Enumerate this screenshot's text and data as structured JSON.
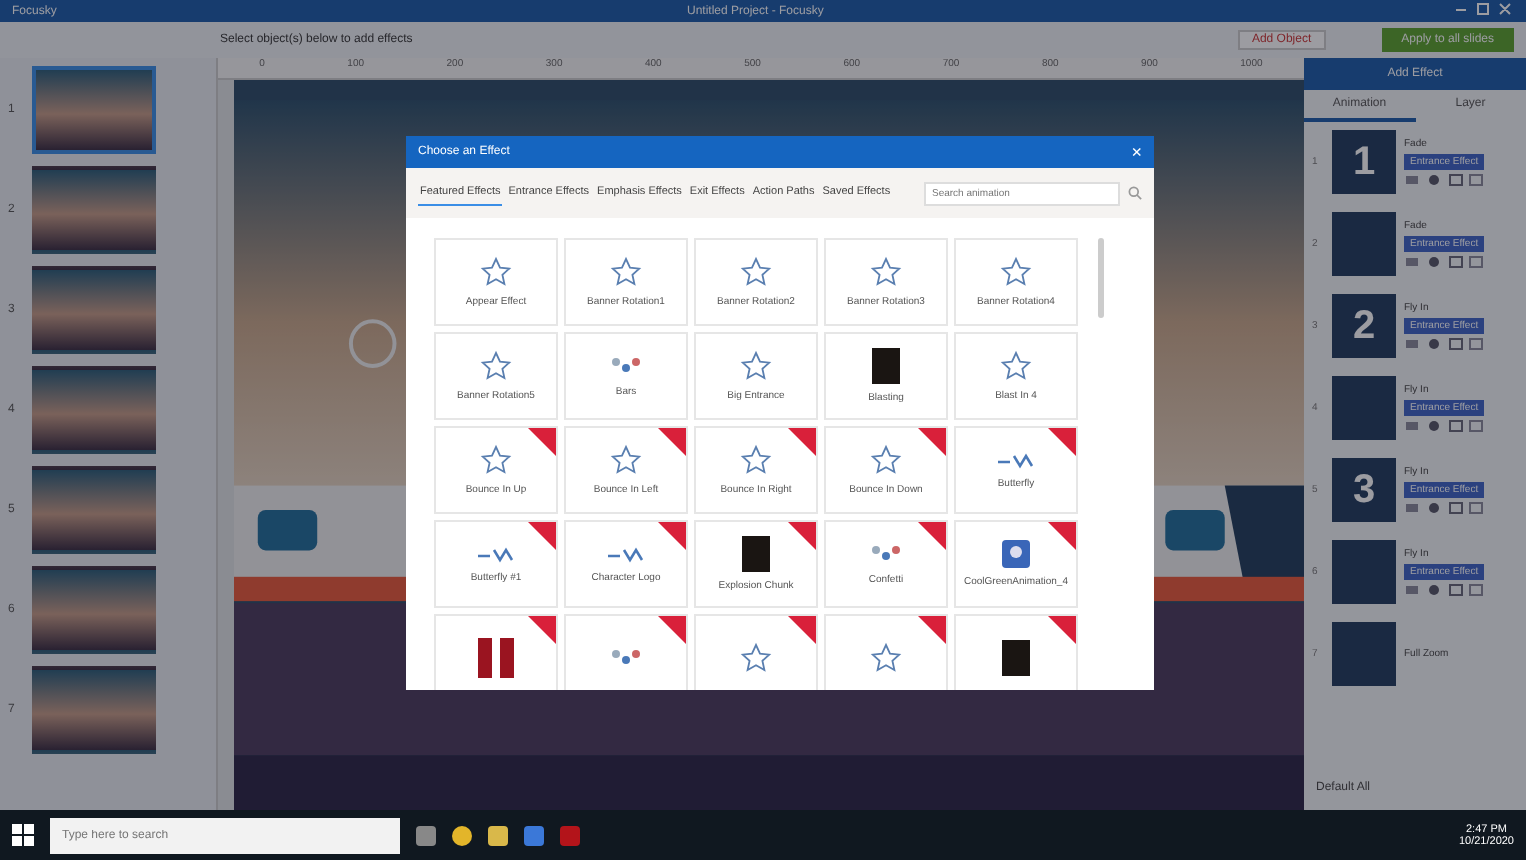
{
  "window": {
    "app": "Focusky",
    "title": "Untitled Project - Focusky"
  },
  "toolbar": {
    "hint": "Select object(s) below to add effects",
    "add_object": "Add Object",
    "apply_button": "Apply to all slides"
  },
  "ruler": [
    "0",
    "100",
    "200",
    "300",
    "400",
    "500",
    "600",
    "700",
    "800",
    "900",
    "1000"
  ],
  "slides": [
    {
      "number": "1",
      "selected": true
    },
    {
      "number": "2",
      "selected": false
    },
    {
      "number": "3",
      "selected": false
    },
    {
      "number": "4",
      "selected": false
    },
    {
      "number": "5",
      "selected": false
    },
    {
      "number": "6",
      "selected": false
    },
    {
      "number": "7",
      "selected": false
    }
  ],
  "dialog": {
    "title": "Choose an Effect",
    "close": "×",
    "tabs": [
      {
        "label": "Featured Effects",
        "selected": true
      },
      {
        "label": "Entrance Effects",
        "selected": false
      },
      {
        "label": "Emphasis Effects",
        "selected": false
      },
      {
        "label": "Exit Effects",
        "selected": false
      },
      {
        "label": "Action Paths",
        "selected": false
      },
      {
        "label": "Saved Effects",
        "selected": false
      }
    ],
    "search": {
      "placeholder": "Search animation"
    },
    "effects": [
      {
        "label": "Appear Effect",
        "kind": "star",
        "premium": false
      },
      {
        "label": "Banner Rotation1",
        "kind": "star",
        "premium": false
      },
      {
        "label": "Banner Rotation2",
        "kind": "star",
        "premium": false
      },
      {
        "label": "Banner Rotation3",
        "kind": "star",
        "premium": false
      },
      {
        "label": "Banner Rotation4",
        "kind": "star",
        "premium": false
      },
      {
        "label": "Banner Rotation5",
        "kind": "star",
        "premium": false
      },
      {
        "label": "Bars",
        "kind": "dots",
        "premium": false
      },
      {
        "label": "Big Entrance",
        "kind": "star",
        "premium": false
      },
      {
        "label": "Blasting",
        "kind": "dark",
        "premium": false
      },
      {
        "label": "Blast In 4",
        "kind": "star",
        "premium": false
      },
      {
        "label": "Bounce In Up",
        "kind": "star",
        "premium": true
      },
      {
        "label": "Bounce In Left",
        "kind": "star",
        "premium": true
      },
      {
        "label": "Bounce In Right",
        "kind": "star",
        "premium": true
      },
      {
        "label": "Bounce In Down",
        "kind": "star",
        "premium": true
      },
      {
        "label": "Butterfly",
        "kind": "logo",
        "premium": true
      },
      {
        "label": "Butterfly #1",
        "kind": "logo",
        "premium": true
      },
      {
        "label": "Character Logo",
        "kind": "logo",
        "premium": true
      },
      {
        "label": "Explosion Chunk",
        "kind": "dark",
        "premium": true
      },
      {
        "label": "Confetti",
        "kind": "dots",
        "premium": true
      },
      {
        "label": "CoolGreenAnimation_4",
        "kind": "square",
        "premium": true
      },
      {
        "kind": "red",
        "premium": true
      },
      {
        "kind": "dots",
        "premium": true
      },
      {
        "kind": "star",
        "premium": true
      },
      {
        "kind": "star",
        "premium": true
      },
      {
        "kind": "dark",
        "premium": true
      }
    ]
  },
  "panel": {
    "add_effect": "Add Effect",
    "tabs": [
      {
        "label": "Animation",
        "selected": true
      },
      {
        "label": "Layer",
        "selected": false
      }
    ],
    "items": [
      {
        "index": "1",
        "thumb": "1",
        "name": "Fade",
        "effect": "Entrance Effect"
      },
      {
        "index": "2",
        "name": "Fade",
        "effect": "Entrance Effect"
      },
      {
        "index": "3",
        "thumb": "2",
        "name": "Fly In",
        "effect": "Entrance Effect"
      },
      {
        "index": "4",
        "name": "Fly In",
        "effect": "Entrance Effect"
      },
      {
        "index": "5",
        "thumb": "3",
        "name": "Fly In",
        "effect": "Entrance Effect"
      },
      {
        "index": "6",
        "name": "Fly In",
        "effect": "Entrance Effect"
      },
      {
        "index": "7",
        "name": "Full Zoom"
      }
    ],
    "default_all": "Default All"
  },
  "taskbar": {
    "search": {
      "placeholder": "Type here to search"
    },
    "time": "2:47 PM",
    "date": "10/21/2020"
  }
}
